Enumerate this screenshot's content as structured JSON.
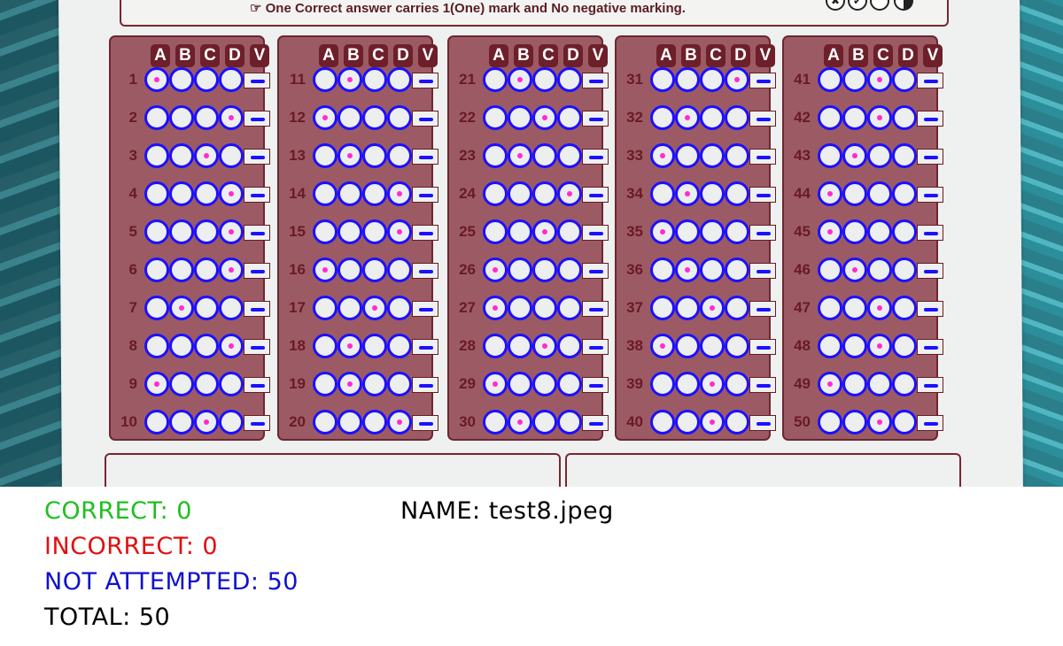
{
  "instruction": "☞ One Correct answer carries 1(One) mark and No negative marking.",
  "legend": {
    "cross": "✖",
    "check": "✔"
  },
  "headers": [
    "A",
    "B",
    "C",
    "D",
    "V"
  ],
  "marked": [
    0,
    3,
    2,
    3,
    3,
    3,
    1,
    3,
    0,
    2,
    1,
    0,
    1,
    3,
    3,
    0,
    2,
    1,
    1,
    3,
    1,
    2,
    1,
    3,
    2,
    0,
    0,
    2,
    0,
    1,
    3,
    1,
    0,
    1,
    0,
    1,
    2,
    0,
    2,
    2,
    2,
    2,
    1,
    0,
    0,
    1,
    2,
    2,
    0,
    2
  ],
  "colors": {
    "ring": "#1d10ff",
    "mark": "#ff2bd0",
    "panel": "#9c5b64",
    "header": "#6d1f2a"
  },
  "results": {
    "correct": "CORRECT: 0",
    "incorrect": "INCORRECT: 0",
    "not_attempted": "NOT ATTEMPTED: 50",
    "total": "TOTAL: 50",
    "name": "NAME: test8.jpeg"
  },
  "result_colors": {
    "correct": "#1fbf1f",
    "incorrect": "#e01010",
    "not_attempted": "#1010d0",
    "total": "#000000"
  }
}
